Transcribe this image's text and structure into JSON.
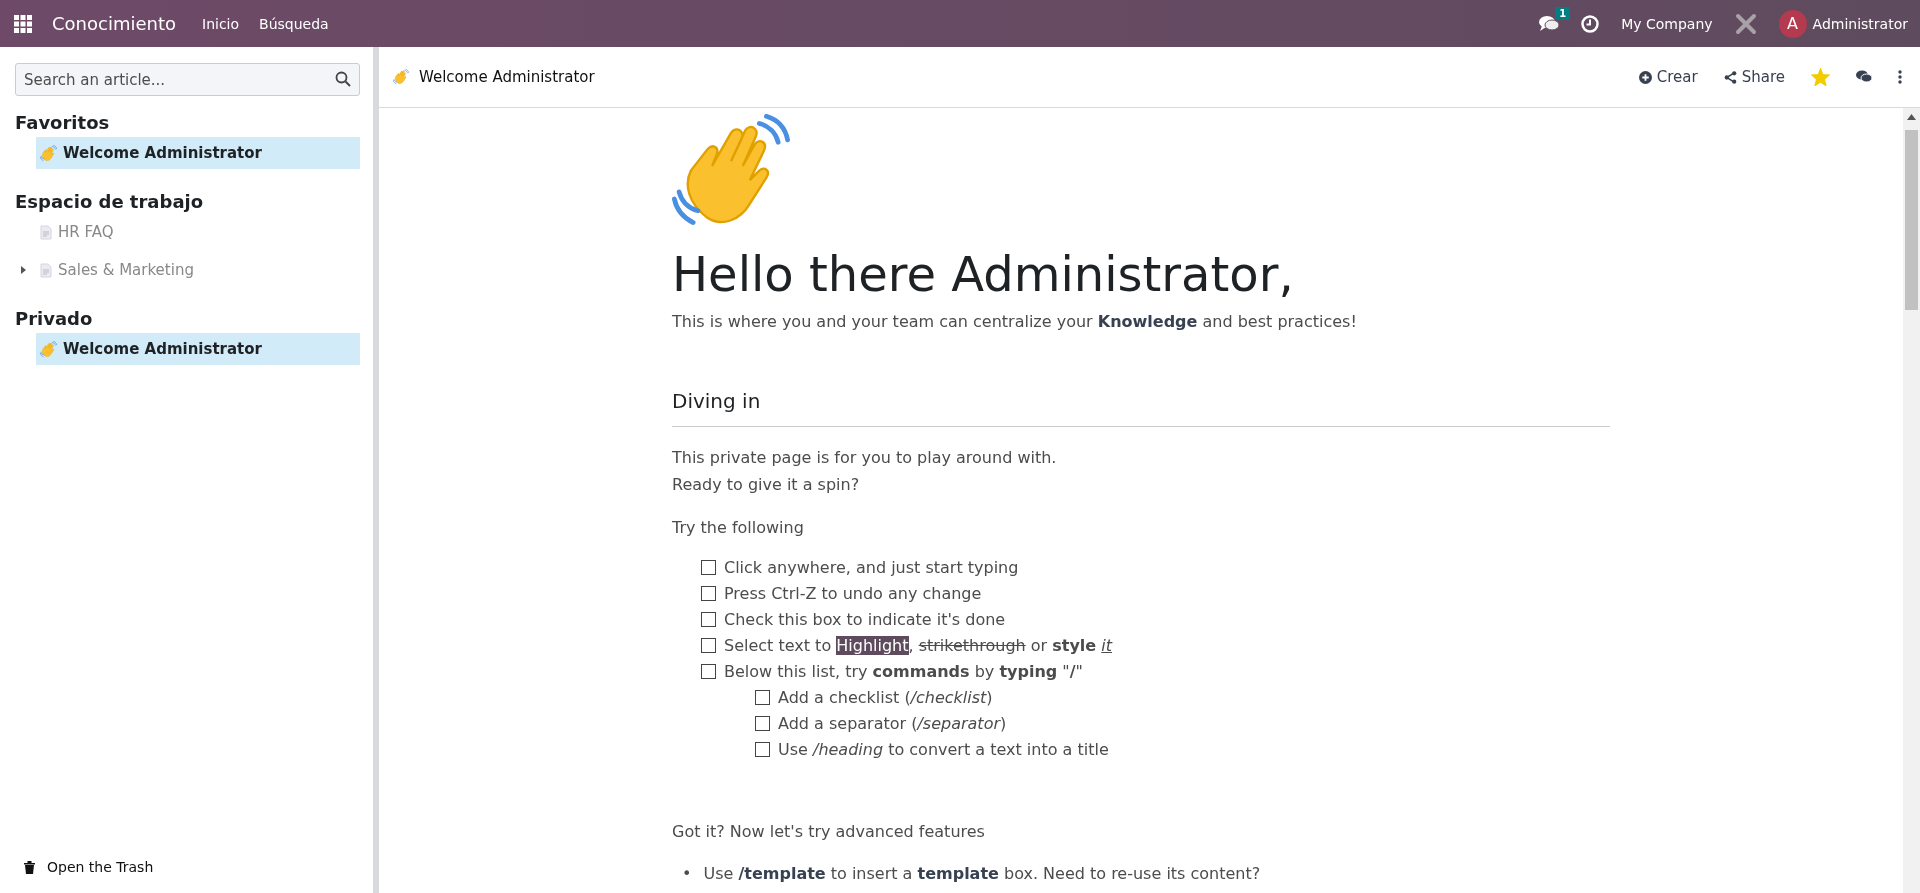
{
  "topbar": {
    "app_name": "Conocimiento",
    "menu": [
      "Inicio",
      "Búsqueda"
    ],
    "messages_badge": "1",
    "company": "My Company",
    "avatar_letter": "A",
    "user": "Administrator"
  },
  "sidebar": {
    "search": {
      "placeholder": "Search an article..."
    },
    "sections": [
      {
        "title": "Favoritos",
        "items": [
          {
            "label": "Welcome Administrator",
            "kind": "emoji",
            "selected": true
          }
        ]
      },
      {
        "title": "Espacio de trabajo",
        "items": [
          {
            "label": "HR FAQ",
            "kind": "page",
            "selected": false
          },
          {
            "label": "Sales & Marketing",
            "kind": "page",
            "selected": false,
            "expanded": false
          }
        ]
      },
      {
        "title": "Privado",
        "items": [
          {
            "label": "Welcome Administrator",
            "kind": "emoji",
            "selected": true
          }
        ]
      }
    ],
    "trash": "Open the Trash"
  },
  "header": {
    "breadcrumb": "Welcome Administrator",
    "create": "Crear",
    "share": "Share",
    "favorite": true
  },
  "document": {
    "title": "Hello there Administrator,",
    "intro": "This is where you and your team can centralize your **Knowledge** and best practices!",
    "section_heading": "Diving in",
    "lines": [
      "This private page is for you to play around with.",
      "Ready to give it a spin?"
    ],
    "try": "Try the following",
    "checklist": [
      {
        "checked": false,
        "segments": [
          {
            "kind": "plain",
            "text": "Click anywhere, and just start typing"
          }
        ]
      },
      {
        "checked": false,
        "segments": [
          {
            "kind": "plain",
            "text": "Press Ctrl-Z to undo any change"
          }
        ]
      },
      {
        "checked": false,
        "segments": [
          {
            "kind": "plain",
            "text": "Check this box to indicate it's done"
          }
        ]
      },
      {
        "checked": false,
        "segments": [
          {
            "kind": "plain",
            "text": "Select text to "
          },
          {
            "kind": "highlight",
            "text": "Highlight"
          },
          {
            "kind": "strike",
            "lead": ", ",
            "text": "strikethrough"
          },
          {
            "kind": "plain",
            "text": " or **style** "
          },
          {
            "kind": "underline",
            "text": "*it*"
          }
        ]
      },
      {
        "checked": false,
        "segments": [
          {
            "kind": "plain",
            "text": "Below this list, try **commands** by **typing** \"**/**\""
          }
        ],
        "children": [
          {
            "checked": false,
            "segments": [
              {
                "kind": "plain",
                "text": "Add a checklist (*/checklist*)"
              }
            ]
          },
          {
            "checked": false,
            "segments": [
              {
                "kind": "plain",
                "text": "Add a separator (*/separator*)"
              }
            ]
          },
          {
            "checked": false,
            "segments": [
              {
                "kind": "plain",
                "text": "Use */heading* to convert a text into a title"
              }
            ]
          }
        ]
      }
    ],
    "advanced": "Got it? Now let's try advanced features",
    "bullets": [
      {
        "marker": "•",
        "text": "Use **/template** to insert a **template** box. Need to re-use its content?"
      }
    ]
  }
}
